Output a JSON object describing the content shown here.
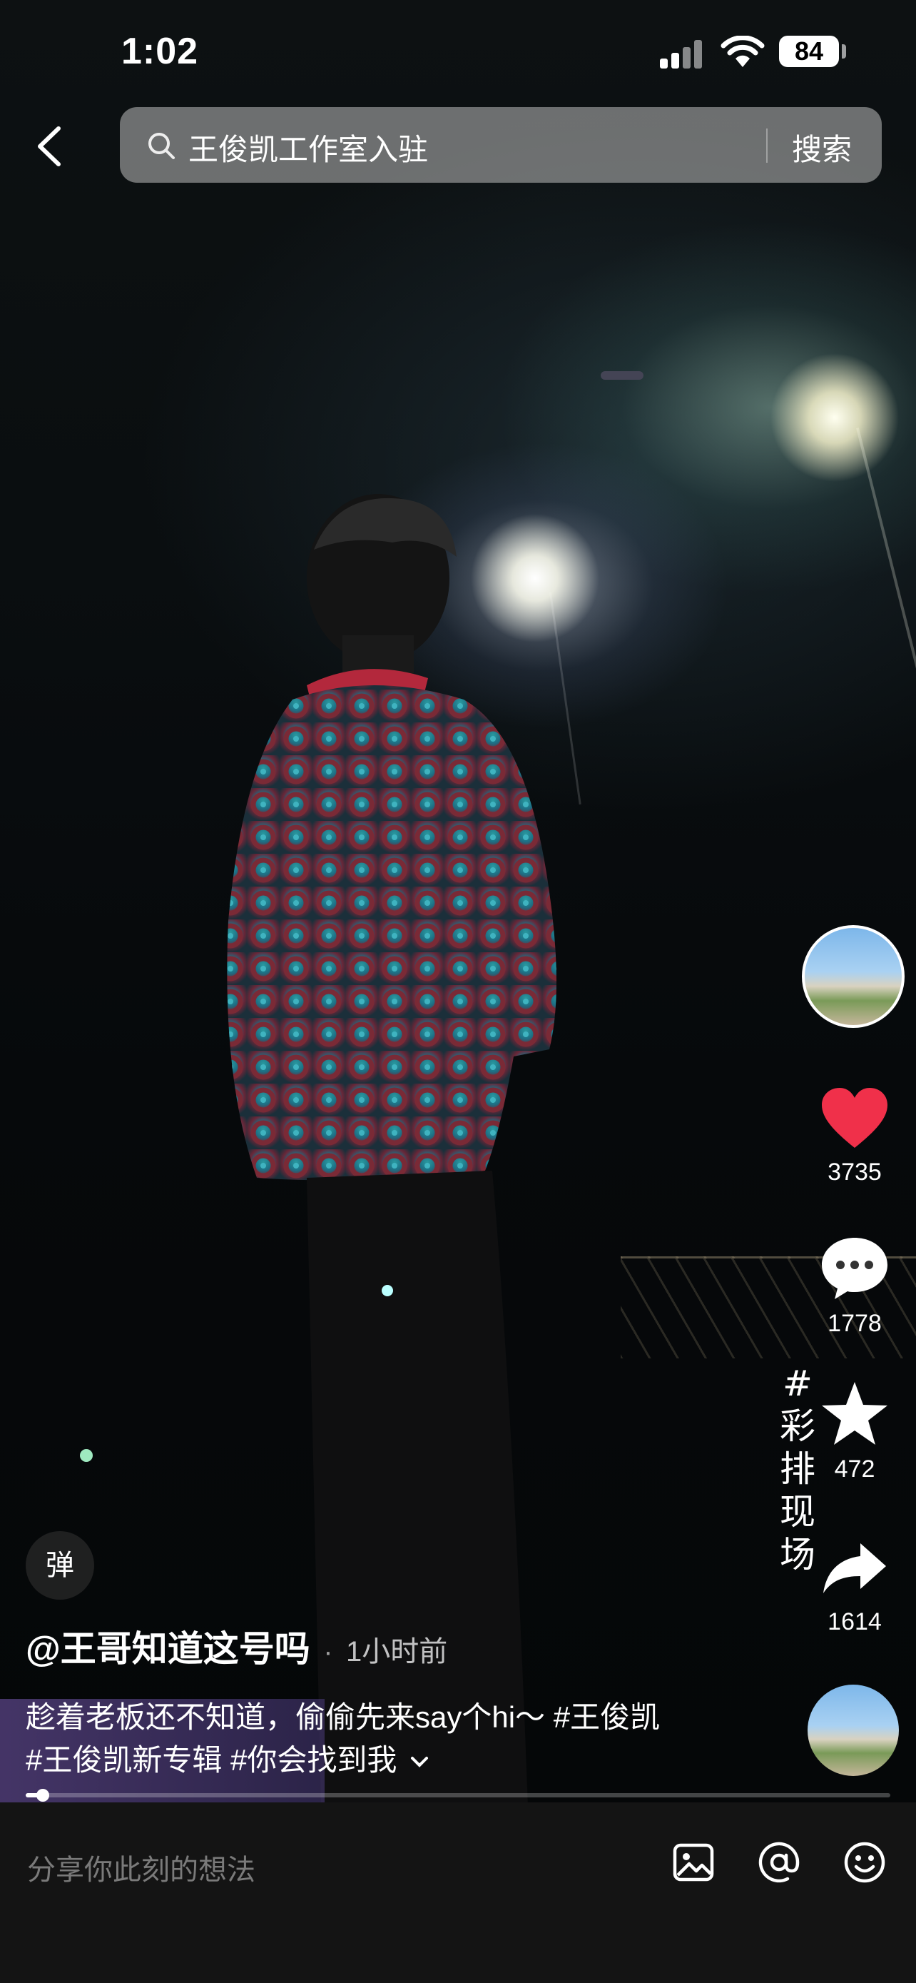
{
  "status_bar": {
    "time": "1:02",
    "battery": "84"
  },
  "search": {
    "query": "王俊凯工作室入驻",
    "button_label": "搜索"
  },
  "video": {
    "vertical_tag": "#彩排现场"
  },
  "actions": {
    "likes": "3735",
    "comments": "1778",
    "favorites": "472",
    "shares": "1614"
  },
  "danmu_label": "弹",
  "post": {
    "author": "@王哥知道这号吗",
    "separator": "·",
    "time": "1小时前",
    "caption_line1_text": "趁着老板还不知道，偷偷先来say个hi～ ",
    "caption_line1_tag": "#王俊凯",
    "caption_line2_tags": "#王俊凯新专辑 #你会找到我",
    "expand_icon": "chevron-down-icon"
  },
  "playback": {
    "progress": 0.02
  },
  "comment_bar": {
    "placeholder": "分享你此刻的想法"
  },
  "colors": {
    "like": "#f0304a",
    "background": "#0b0d0e",
    "comment_bar": "#141414"
  }
}
